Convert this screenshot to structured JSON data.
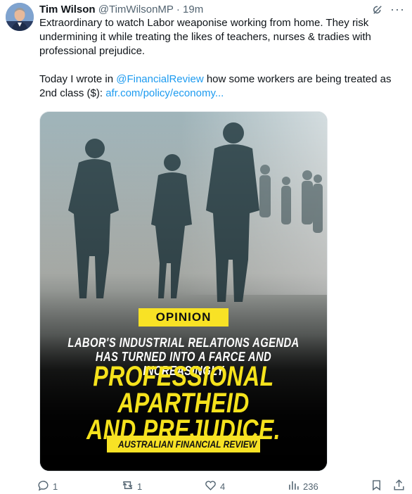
{
  "tweet": {
    "author_name": "Tim Wilson",
    "handle": "@TimWilsonMP",
    "separator": "·",
    "time": "19m",
    "text_line1": "Extraordinary to watch Labor weaponise working from home. They risk undermining it while treating the likes of teachers, nurses & tradies with professional prejudice.",
    "text_line2_prefix": "Today I wrote in ",
    "mention": "@FinancialReview",
    "text_line2_middle": " how some workers are being treated as 2nd class ($): ",
    "url": "afr.com/policy/economy..."
  },
  "media": {
    "badge": "OPINION",
    "headline_white": "LABOR'S INDUSTRIAL RELATIONS AGENDA\nHAS TURNED INTO A FARCE AND INCREASINGLY",
    "headline_yellow": "PROFESSIONAL APARTHEID\nAND PREJUDICE.",
    "source": "AUSTRALIAN FINANCIAL REVIEW"
  },
  "actions": {
    "replies": "1",
    "reposts": "1",
    "likes": "4",
    "views": "236"
  },
  "icons": [
    "avatar",
    "grok-icon",
    "more-icon",
    "reply-icon",
    "repost-icon",
    "like-icon",
    "views-icon",
    "bookmark-icon",
    "share-icon"
  ],
  "colors": {
    "link": "#1d9bf0",
    "muted": "#536471",
    "badge": "#f8e225",
    "headline_yellow": "#f5e21c"
  }
}
